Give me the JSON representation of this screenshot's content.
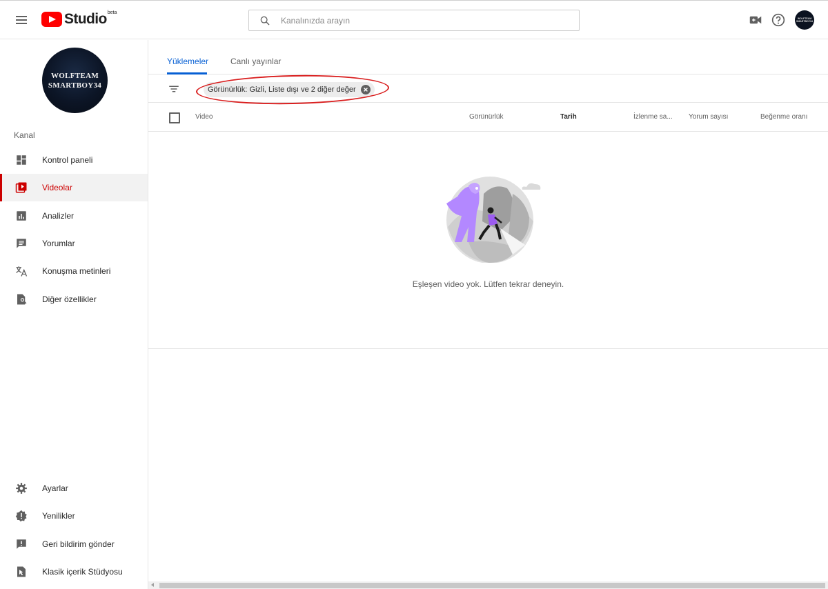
{
  "header": {
    "logo_text": "Studio",
    "logo_badge": "beta",
    "search_placeholder": "Kanalınızda arayın",
    "avatar_text": "WOLFTEAM SMARTBOY34"
  },
  "sidebar": {
    "avatar_line1": "WOLFTEAM",
    "avatar_line2": "SMARTBOY34",
    "section_label": "Kanal",
    "items": [
      {
        "label": "Kontrol paneli",
        "icon": "dashboard-icon"
      },
      {
        "label": "Videolar",
        "icon": "videos-icon",
        "active": true
      },
      {
        "label": "Analizler",
        "icon": "analytics-icon"
      },
      {
        "label": "Yorumlar",
        "icon": "comments-icon"
      },
      {
        "label": "Konuşma metinleri",
        "icon": "translate-icon"
      },
      {
        "label": "Diğer özellikler",
        "icon": "other-features-icon"
      }
    ],
    "bottom_items": [
      {
        "label": "Ayarlar",
        "icon": "gear-icon"
      },
      {
        "label": "Yenilikler",
        "icon": "whats-new-icon"
      },
      {
        "label": "Geri bildirim gönder",
        "icon": "feedback-icon"
      },
      {
        "label": "Klasik içerik Stüdyosu",
        "icon": "classic-studio-icon"
      }
    ]
  },
  "tabs": [
    {
      "label": "Yüklemeler",
      "active": true
    },
    {
      "label": "Canlı yayınlar",
      "active": false
    }
  ],
  "filter": {
    "chip_label": "Görünürlük: Gizli, Liste dışı ve 2 diğer değer"
  },
  "table": {
    "columns": [
      "Video",
      "Görünürlük",
      "Tarih",
      "İzlenme sa...",
      "Yorum sayısı",
      "Beğenme oranı"
    ]
  },
  "empty_state": {
    "message": "Eşleşen video yok. Lütfen tekrar deneyin."
  },
  "colors": {
    "accent": "#065fd4",
    "brand_red": "#ff0000",
    "active_nav": "#cc0000",
    "annotation": "#d91e1e"
  }
}
